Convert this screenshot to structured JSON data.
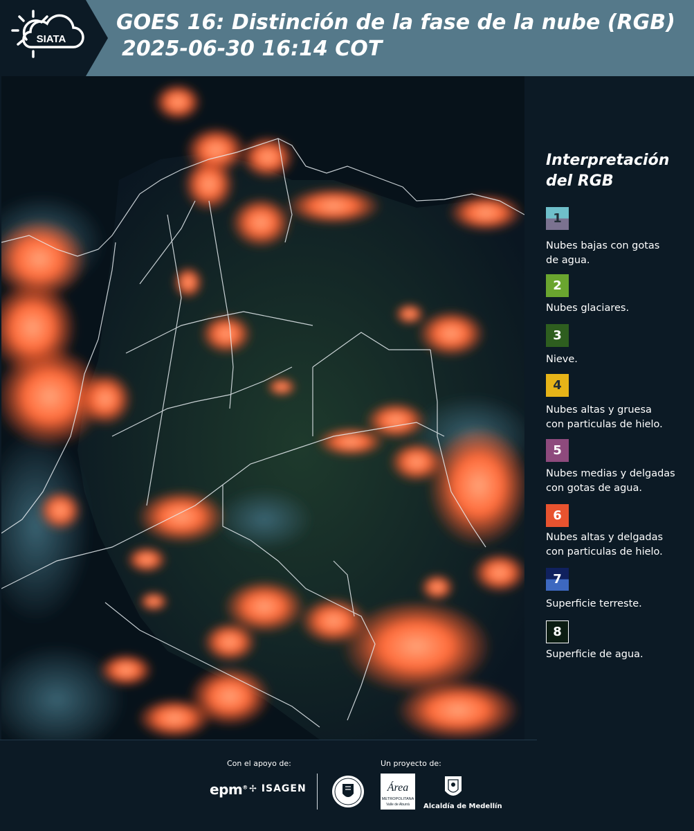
{
  "header": {
    "logo_text": "SIATA",
    "title_line1": "GOES 16: Distinción de la fase de la nube (RGB)",
    "title_line2": "2025-06-30 16:14 COT",
    "bg_color": "#55798a",
    "logo_bg_color": "#0c1a25"
  },
  "legend": {
    "title_line1": "Interpretación",
    "title_line2": "del RGB",
    "items": [
      {
        "number": "1",
        "label_lines": [
          "Nubes bajas con gotas",
          "de agua."
        ],
        "colors": [
          "#6fbfca",
          "#7b7290"
        ]
      },
      {
        "number": "2",
        "label_lines": [
          "Nubes glaciares."
        ],
        "colors": [
          "#6aa52f"
        ]
      },
      {
        "number": "3",
        "label_lines": [
          "Nieve."
        ],
        "colors": [
          "#2e5e1f"
        ]
      },
      {
        "number": "4",
        "label_lines": [
          "Nubes altas y gruesa",
          "con particulas de hielo."
        ],
        "colors": [
          "#e7b418"
        ]
      },
      {
        "number": "5",
        "label_lines": [
          "Nubes medias y delgadas",
          "con gotas de agua."
        ],
        "colors": [
          "#8e4a7d"
        ]
      },
      {
        "number": "6",
        "label_lines": [
          "Nubes altas y delgadas",
          "con particulas de hielo."
        ],
        "colors": [
          "#e8532f"
        ]
      },
      {
        "number": "7",
        "label_lines": [
          "Superficie terreste."
        ],
        "colors": [
          "#10215e",
          "#3d68c0"
        ]
      },
      {
        "number": "8",
        "label_lines": [
          "Superficie de agua."
        ],
        "colors": [
          "#0b1c12"
        ]
      }
    ]
  },
  "footer": {
    "support_label": "Con el apoyo de:",
    "project_label": "Un proyecto de:",
    "epm_text": "epm",
    "isagen_text": "ISAGEN",
    "area_text": "Área",
    "area_sub": "METROPOLITANA",
    "area_sub2": "Valle de Aburrá",
    "alcaldia_text": "Alcaldía de Medellín"
  }
}
